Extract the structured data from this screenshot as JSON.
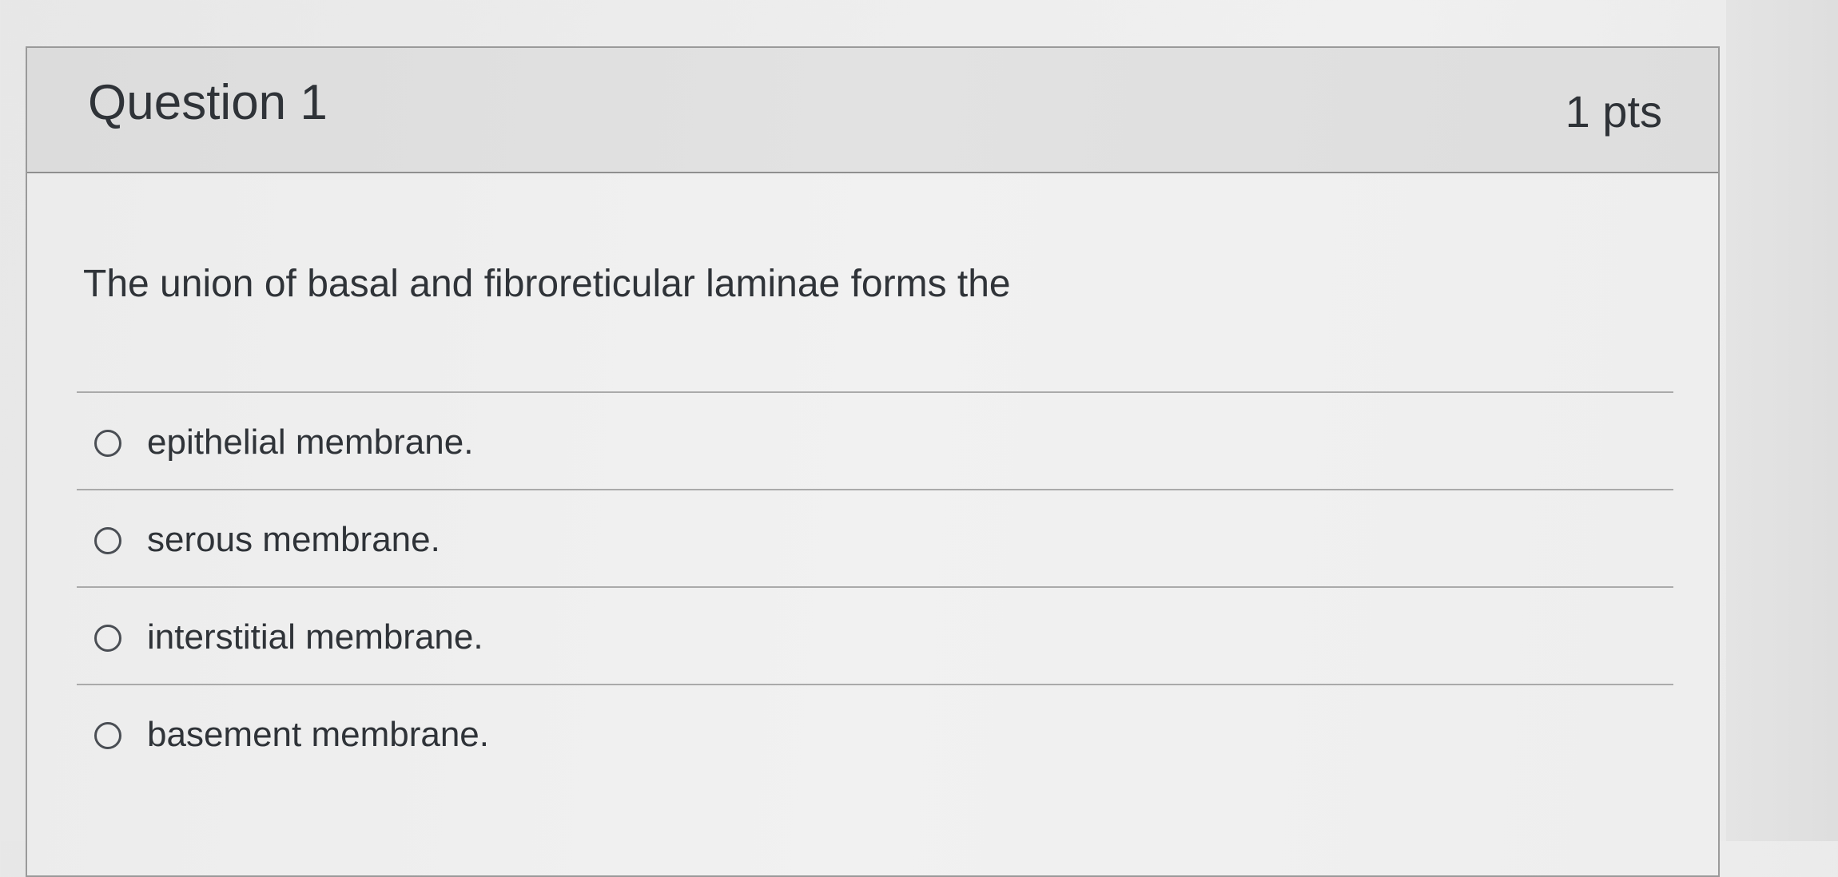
{
  "question": {
    "title": "Question 1",
    "points": "1 pts",
    "text": "The union of basal and fibroreticular laminae forms the",
    "selected": null
  },
  "answers": [
    {
      "label": "epithelial membrane.",
      "icon": "radio-unselected-icon"
    },
    {
      "label": "serous membrane.",
      "icon": "radio-unselected-icon"
    },
    {
      "label": "interstitial membrane.",
      "icon": "radio-unselected-icon"
    },
    {
      "label": "basement membrane.",
      "icon": "radio-unselected-icon"
    }
  ],
  "colors": {
    "header_bg": "#e0e0e0",
    "card_bg": "#efefef",
    "border": "#9a9a9a",
    "text": "#2f3338"
  }
}
